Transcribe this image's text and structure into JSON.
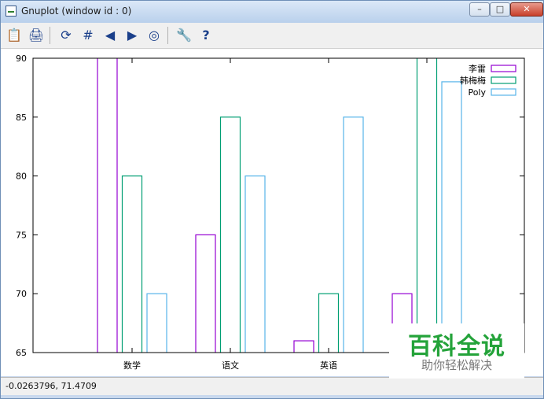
{
  "window": {
    "title": "Gnuplot (window id : 0)",
    "minimize_glyph": "–",
    "maximize_glyph": "□",
    "close_glyph": "✕"
  },
  "toolbar": {
    "buttons": [
      {
        "name": "clipboard-icon",
        "glyph": "📋"
      },
      {
        "name": "print-icon",
        "glyph": "🖨"
      },
      {
        "name": "replot-icon",
        "glyph": "⟳"
      },
      {
        "name": "grid-icon",
        "glyph": "#"
      },
      {
        "name": "zoom-previous-icon",
        "glyph": "◀"
      },
      {
        "name": "zoom-next-icon",
        "glyph": "▶"
      },
      {
        "name": "unzoom-icon",
        "glyph": "◎"
      },
      {
        "name": "options-icon",
        "glyph": "🔧"
      },
      {
        "name": "help-icon",
        "glyph": "?"
      }
    ]
  },
  "status": {
    "coords": "-0.0263796,  71.4709"
  },
  "watermark": {
    "main": "百科全说",
    "sub": "助你轻松解决"
  },
  "colors": {
    "series1": "#9400d3",
    "series2": "#009e73",
    "series3": "#56b4e9"
  },
  "chart_data": {
    "type": "bar",
    "categories": [
      "数学",
      "语文",
      "英语",
      ""
    ],
    "series": [
      {
        "name": "李雷",
        "values": [
          91,
          75,
          66,
          70
        ]
      },
      {
        "name": "韩梅梅",
        "values": [
          80,
          85,
          70,
          91
        ]
      },
      {
        "name": "Poly",
        "values": [
          70,
          80,
          85,
          88
        ]
      }
    ],
    "ylim": [
      65,
      90
    ],
    "yticks": [
      65,
      70,
      75,
      80,
      85,
      90
    ],
    "legend_position": "top-right",
    "grid": false
  }
}
